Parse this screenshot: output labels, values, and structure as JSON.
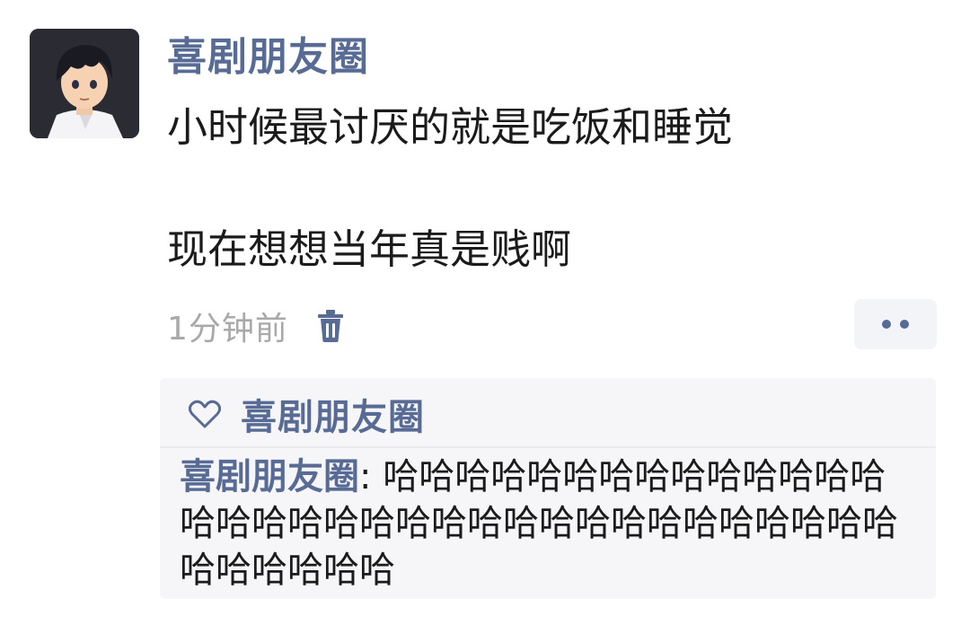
{
  "post": {
    "nickname": "喜剧朋友圈",
    "lines": [
      "小时候最讨厌的就是吃饭和睡觉",
      "现在想想当年真是贱啊"
    ],
    "timestamp": "1分钟前",
    "icons": {
      "avatar": "anime-boy-avatar",
      "delete": "trash-icon",
      "more": "more-dots-icon"
    }
  },
  "interactions": {
    "like_icon": "heart-outline-icon",
    "liker": "喜剧朋友圈",
    "comment": {
      "author": "喜剧朋友圈",
      "separator": ": ",
      "text": "哈哈哈哈哈哈哈哈哈哈哈哈哈哈哈哈哈哈哈哈哈哈哈哈哈哈哈哈哈哈哈哈哈哈哈哈哈哈哈哈"
    }
  },
  "colors": {
    "link_blue": "#576b95",
    "text": "#1b1b1b",
    "muted": "#a9a9a9",
    "panel": "#f6f6f8"
  }
}
